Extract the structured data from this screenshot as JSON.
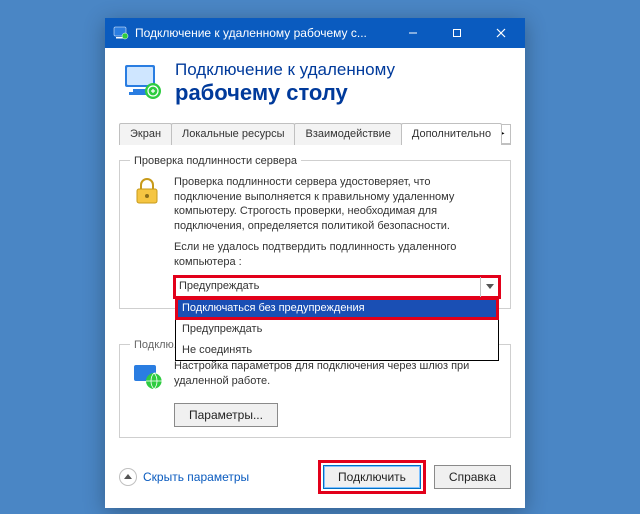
{
  "window": {
    "title": "Подключение к удаленному рабочему с..."
  },
  "header": {
    "line1": "Подключение к удаленному",
    "line2": "рабочему столу"
  },
  "tabs": {
    "items": [
      {
        "label": "Экран"
      },
      {
        "label": "Локальные ресурсы"
      },
      {
        "label": "Взаимодействие"
      },
      {
        "label": "Дополнительно"
      }
    ],
    "active_index": 3,
    "nav_left": "◂",
    "nav_right": "▸"
  },
  "group1": {
    "legend": "Проверка подлинности сервера",
    "para1": "Проверка подлинности сервера удостоверяет, что подключение выполняется к правильному удаленному компьютеру. Строгость проверки, необходимая для подключения, определяется политикой безопасности.",
    "para2": "Если не удалось подтвердить подлинность удаленного компьютера :",
    "combo_value": "Предупреждать",
    "options": [
      "Подключаться без предупреждения",
      "Предупреждать",
      "Не соединять"
    ],
    "selected_option_index": 0
  },
  "group2": {
    "legend": "Подклю...",
    "para": "Настройка параметров для подключения через шлюз при удаленной работе.",
    "params_btn": "Параметры..."
  },
  "footer": {
    "toggle": "Скрыть параметры",
    "connect": "Подключить",
    "help": "Справка"
  }
}
